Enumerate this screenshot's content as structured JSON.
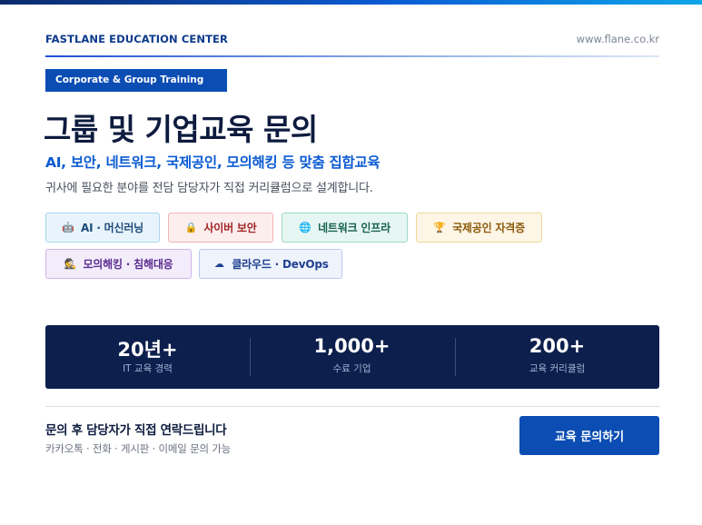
{
  "header": {
    "brand": "FASTLANE EDUCATION CENTER",
    "site": "www.flane.co.kr"
  },
  "tag": "Corporate & Group Training",
  "title": "그룹 및 기업교육 문의",
  "subtitle": "AI, 보안, 네트워크, 국제공인, 모의해킹 등 맞춤 집합교육",
  "description": "귀사에 필요한 분야를 전담 담당자가 직접 커리큘럼으로 설계합니다.",
  "chips": [
    {
      "icon": "robot-icon",
      "glyph": "🤖",
      "label": "AI · 머신러닝",
      "bg": "#e8f4fc",
      "border": "#a9d4f0",
      "color": "#1d4a7a"
    },
    {
      "icon": "lock-icon",
      "glyph": "🔒",
      "label": "사이버 보안",
      "bg": "#fdeeee",
      "border": "#f0b4b4",
      "color": "#a12626"
    },
    {
      "icon": "globe-icon",
      "glyph": "🌐",
      "label": "네트워크 인프라",
      "bg": "#e6f6f2",
      "border": "#9fd9c9",
      "color": "#17624f"
    },
    {
      "icon": "trophy-icon",
      "glyph": "🏆",
      "label": "국제공인 자격증",
      "bg": "#fdf6e6",
      "border": "#f0d79a",
      "color": "#8a5a0a"
    },
    {
      "icon": "hacker-icon",
      "glyph": "🕵",
      "label": "모의해킹 · 침해대응",
      "bg": "#f3ecfb",
      "border": "#cdb5ea",
      "color": "#5b2d91"
    },
    {
      "icon": "cloud-icon",
      "glyph": "☁",
      "label": "클라우드 · DevOps",
      "bg": "#eef3fc",
      "border": "#b8cbef",
      "color": "#1e3f8f"
    }
  ],
  "stats": [
    {
      "value": "20년+",
      "label": "IT 교육 경력"
    },
    {
      "value": "1,000+",
      "label": "수료 기업"
    },
    {
      "value": "200+",
      "label": "교육 커리큘럼"
    }
  ],
  "cta": {
    "title": "문의 후 담당자가 직접 연락드립니다",
    "subtitle": "카카오톡 · 전화 · 게시판 · 이메일 문의 가능",
    "button": "교육 문의하기"
  }
}
